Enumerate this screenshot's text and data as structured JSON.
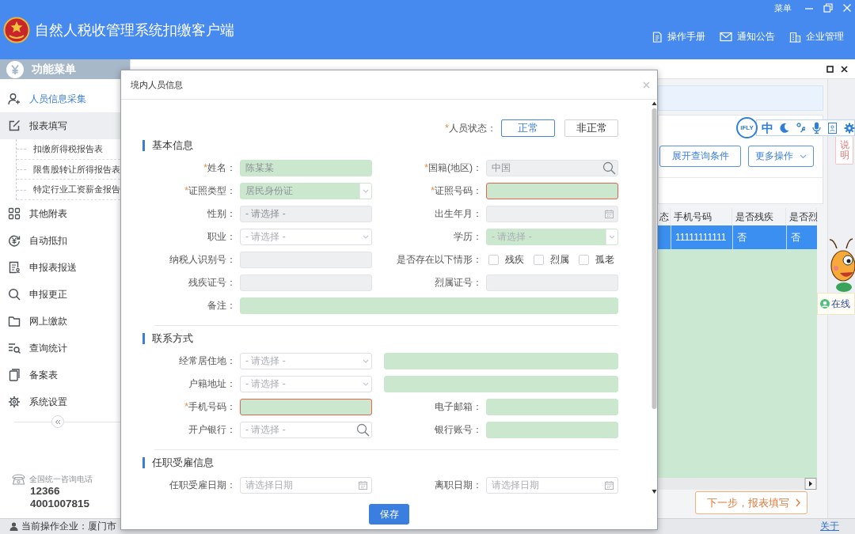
{
  "window": {
    "title": "自然人税收管理系统扣缴客户端",
    "menu": "菜单"
  },
  "header_links": [
    {
      "label": "操作手册"
    },
    {
      "label": "通知公告"
    },
    {
      "label": "企业管理"
    }
  ],
  "sidebar": {
    "title": "功能菜单",
    "items": [
      {
        "label": "人员信息采集",
        "selected": true,
        "expanded": false
      },
      {
        "label": "报表填写",
        "selected": false,
        "expanded": true,
        "children": [
          {
            "label": "扣缴所得税报告表",
            "selected": false
          },
          {
            "label": "限售股转让所得报告表",
            "selected": false
          },
          {
            "label": "特定行业工资薪金报告",
            "selected": false
          }
        ]
      },
      {
        "label": "其他附表",
        "selected": false,
        "expanded": false
      },
      {
        "label": "自动抵扣",
        "selected": false,
        "expanded": false
      },
      {
        "label": "申报表报送",
        "selected": false,
        "expanded": false
      },
      {
        "label": "申报更正",
        "selected": false,
        "expanded": false
      },
      {
        "label": "网上缴款",
        "selected": false,
        "expanded": false
      },
      {
        "label": "查询统计",
        "selected": false,
        "expanded": false
      },
      {
        "label": "备案表",
        "selected": false,
        "expanded": false
      },
      {
        "label": "系统设置",
        "selected": false,
        "expanded": false
      }
    ],
    "hotline": {
      "caption": "全国统一咨询电话",
      "numbers": [
        "12366",
        "4001007815"
      ]
    }
  },
  "main": {
    "toolbar": {
      "buttons": [
        {
          "label": "展开查询条件",
          "kind": "button"
        },
        {
          "label": "更多操作",
          "kind": "dropdown"
        }
      ]
    },
    "voice_toolbar": {
      "badge": "iFLY",
      "language": "中"
    },
    "help_tab": "说明",
    "table": {
      "columns": [
        "态",
        "手机号码",
        "是否残疾",
        "是否烈"
      ],
      "rows": [
        {
          "selected": true,
          "cells": [
            "",
            "11111111111",
            "否",
            "否"
          ]
        }
      ]
    },
    "next_button": "下一步，报表填写",
    "online_chip": "在线"
  },
  "dialog": {
    "title": "境内人员信息",
    "status": {
      "mark": "*",
      "label": "人员状态：",
      "options": [
        {
          "label": "正常",
          "selected": true
        },
        {
          "label": "非正常",
          "selected": false
        }
      ]
    },
    "sections": [
      {
        "title": "基本信息",
        "fields": [
          {
            "kind": "text",
            "mark": "*",
            "label": "姓名：",
            "value": "陈某某",
            "highlighted": true,
            "disabled": false,
            "error": false
          },
          {
            "kind": "search",
            "mark": "*",
            "label": "国籍(地区)：",
            "value": "中国",
            "highlighted": false,
            "disabled": true,
            "error": false
          },
          {
            "kind": "select",
            "mark": "*",
            "label": "证照类型：",
            "value": "居民身份证",
            "highlighted": true,
            "disabled": false,
            "error": false
          },
          {
            "kind": "text",
            "mark": "*",
            "label": "证照号码：",
            "highlighted": true,
            "disabled": false,
            "error": true
          },
          {
            "kind": "select",
            "label": "性别：",
            "value": "- 请选择 -",
            "highlighted": false,
            "disabled": true,
            "error": false
          },
          {
            "kind": "date",
            "label": "出生年月：",
            "highlighted": false,
            "disabled": true,
            "error": false
          },
          {
            "kind": "select",
            "label": "职业：",
            "placeholder": "- 请选择 -",
            "highlighted": false,
            "disabled": false,
            "error": false
          },
          {
            "kind": "select",
            "label": "学历：",
            "placeholder": "- 请选择 -",
            "highlighted": true,
            "disabled": false,
            "error": false
          },
          {
            "kind": "text",
            "label": "纳税人识别号：",
            "highlighted": false,
            "disabled": true,
            "error": false
          },
          {
            "kind": "checks",
            "label": "是否存在以下情形：",
            "options": [
              {
                "label": "残疾",
                "checked": false
              },
              {
                "label": "烈属",
                "checked": false
              },
              {
                "label": "孤老",
                "checked": false
              }
            ]
          },
          {
            "kind": "text",
            "label": "残疾证号：",
            "highlighted": false,
            "disabled": true,
            "error": false
          },
          {
            "kind": "text",
            "label": "烈属证号：",
            "highlighted": false,
            "disabled": true,
            "error": false
          },
          {
            "kind": "wide_text",
            "label": "备注：",
            "highlighted": true,
            "disabled": false,
            "error": false
          }
        ]
      },
      {
        "title": "联系方式",
        "fields": [
          {
            "kind": "select",
            "label": "经常居住地：",
            "placeholder": "- 请选择 -",
            "highlighted": false,
            "disabled": false,
            "error": false
          },
          {
            "kind": "detail",
            "highlighted": true,
            "disabled": false,
            "error": false
          },
          {
            "kind": "select",
            "label": "户籍地址：",
            "placeholder": "- 请选择 -",
            "highlighted": false,
            "disabled": false,
            "error": false
          },
          {
            "kind": "detail",
            "highlighted": true,
            "disabled": false,
            "error": false
          },
          {
            "kind": "text",
            "mark": "*",
            "label": "手机号码：",
            "highlighted": true,
            "disabled": false,
            "error": true
          },
          {
            "kind": "text",
            "label": "电子邮箱：",
            "highlighted": true,
            "disabled": false,
            "error": false
          },
          {
            "kind": "search",
            "label": "开户银行：",
            "placeholder": "- 请选择 -",
            "highlighted": false,
            "disabled": false,
            "error": false
          },
          {
            "kind": "text",
            "label": "银行账号：",
            "highlighted": true,
            "disabled": false,
            "error": false
          }
        ]
      },
      {
        "title": "任职受雇信息",
        "fields": [
          {
            "kind": "date",
            "label": "任职受雇日期：",
            "placeholder": "请选择日期",
            "highlighted": false,
            "disabled": false,
            "error": false
          },
          {
            "kind": "date",
            "label": "离职日期：",
            "placeholder": "请选择日期",
            "highlighted": false,
            "disabled": false,
            "error": false
          }
        ]
      }
    ],
    "save": "保存"
  },
  "status_bar": {
    "company": "当前操作企业：厦门市",
    "about": "关于"
  }
}
